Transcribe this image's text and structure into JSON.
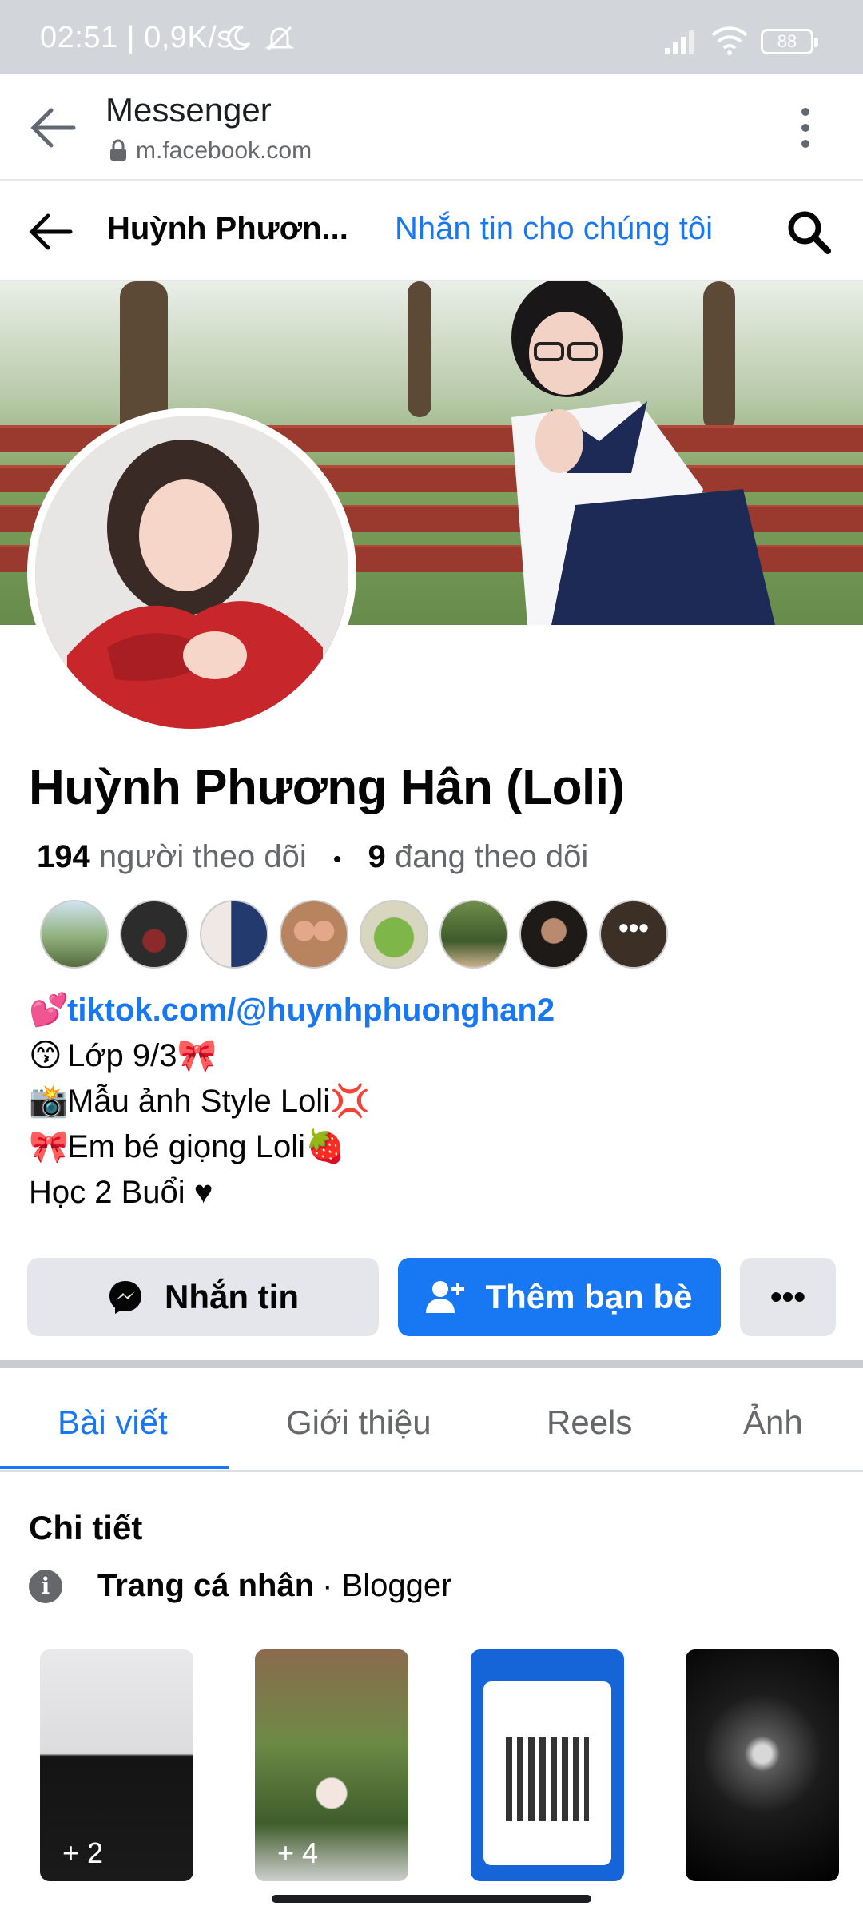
{
  "status_bar": {
    "time": "02:51",
    "speed": "0,9K/s",
    "battery": "88"
  },
  "browser": {
    "title": "Messenger",
    "url": "m.facebook.com"
  },
  "header": {
    "name": "Huỳnh Phươn...",
    "message_link": "Nhắn tin cho chúng tôi"
  },
  "profile": {
    "name": "Huỳnh Phương Hân (Loli)",
    "followers_count": "194",
    "followers_label": "người theo dõi",
    "following_count": "9",
    "following_label": "đang theo dõi",
    "friends_more": "•••"
  },
  "bio": {
    "line1": "tiktok.com/@huynhphuonghan2",
    "line2": "Lớp 9/3",
    "line3": "Mẫu ảnh Style Loli",
    "line4": "Em bé giọng Loli",
    "line5": "Học 2 Buổi ♥"
  },
  "actions": {
    "message": "Nhắn tin",
    "add_friend": "Thêm bạn bè",
    "more": "•••"
  },
  "tabs": [
    "Bài viết",
    "Giới thiệu",
    "Reels",
    "Ảnh"
  ],
  "details": {
    "title": "Chi tiết",
    "page_type": "Trang cá nhân",
    "category": "· Blogger"
  },
  "photos": [
    {
      "count": "+ 2"
    },
    {
      "count": "+ 4"
    },
    {
      "count": ""
    },
    {
      "count": ""
    }
  ],
  "colors": {
    "accent": "#1877f2",
    "button_grey": "#e4e6eb"
  }
}
